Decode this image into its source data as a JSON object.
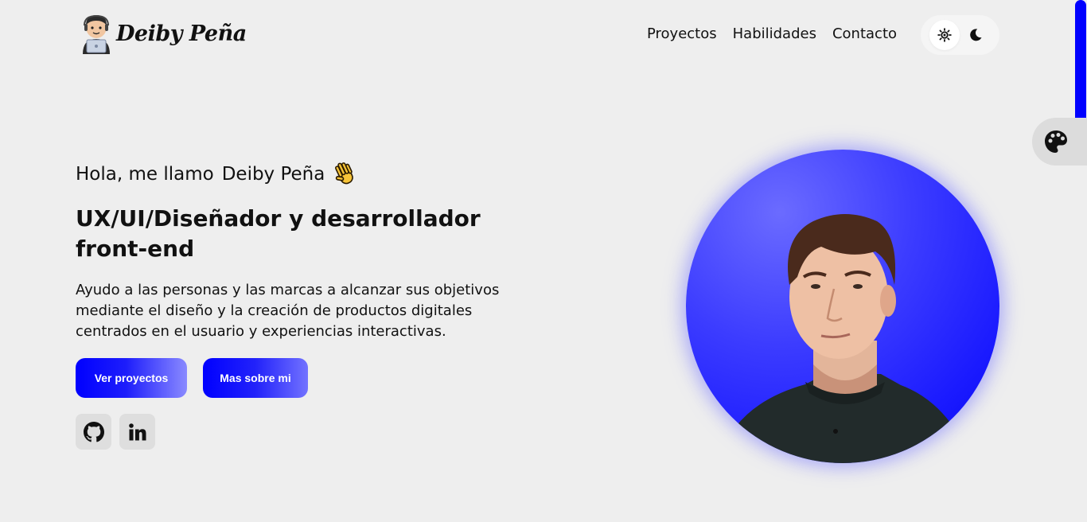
{
  "header": {
    "logo_text": "Deiby Peña",
    "logo_avatar_icon": "developer-avatar-icon",
    "nav": [
      {
        "label": "Proyectos"
      },
      {
        "label": "Habilidades"
      },
      {
        "label": "Contacto"
      }
    ],
    "theme_toggle": {
      "light_icon": "sun-icon",
      "dark_icon": "moon-icon",
      "active": "light"
    }
  },
  "palette_tab": {
    "icon": "palette-icon"
  },
  "hero": {
    "greeting": "Hola, me llamo",
    "name": "Deiby Peña",
    "wave_icon": "waving-hand-icon",
    "headline": "UX/UI/Diseñador y desarrollador front-end",
    "description": "Ayudo a las personas y las marcas a alcanzar sus objetivos mediante el diseño y la creación de productos digitales centrados en el usuario y experiencias interactivas.",
    "buttons": [
      {
        "label": "Ver proyectos"
      },
      {
        "label": "Mas sobre mi"
      }
    ],
    "social": [
      {
        "icon": "github-icon"
      },
      {
        "icon": "linkedin-icon"
      }
    ],
    "portrait_image": "profile-photo"
  },
  "colors": {
    "accent": "#0000ff",
    "background": "#eeeeee",
    "text": "#111111"
  }
}
